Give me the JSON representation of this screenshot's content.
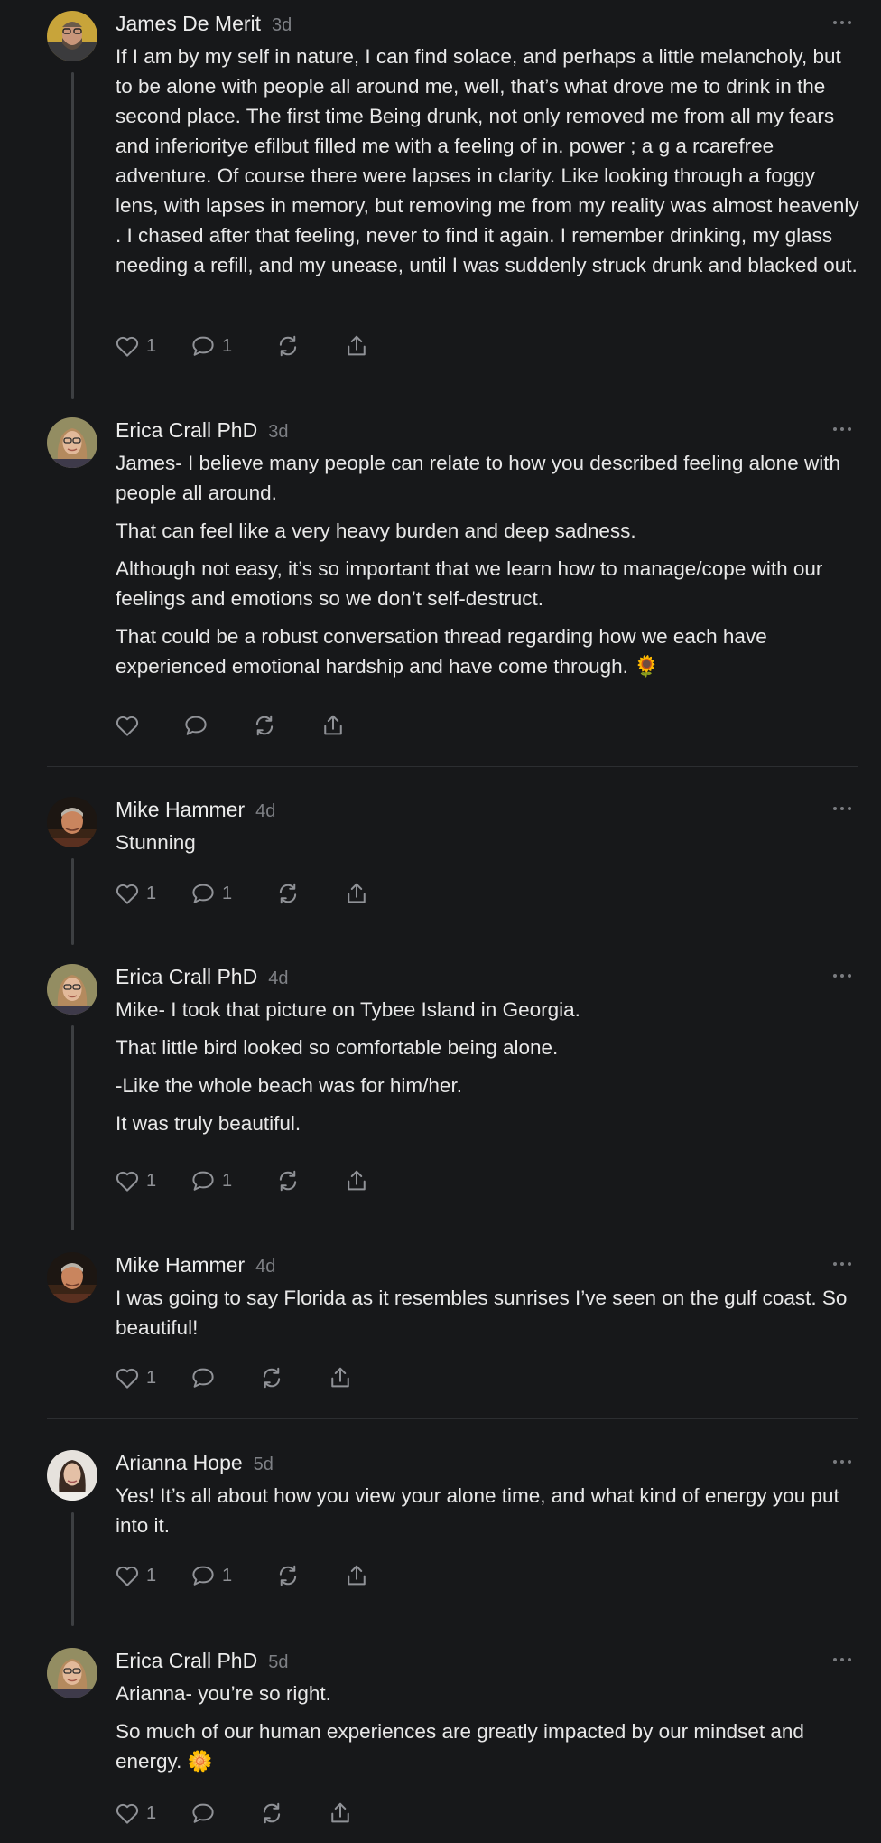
{
  "colors": {
    "background": "#17181a",
    "text": "#e8e8e8",
    "muted": "#7e8085",
    "thread_line": "#3d3f42"
  },
  "comments": [
    {
      "author": "James De Merit",
      "time": "3d",
      "avatar": "man-glasses-beard-avatar",
      "paragraphs": [
        "If I am by my self in nature, I can find solace, and perhaps a little melancholy, but to be alone with people all around me, well, that’s what drove me to drink in the second place. The first time Being drunk, not only removed me from all my fears and inferioritye efilbut filled me with a feeling of in. power ; a g a rcarefree adventure. Of course there were lapses in clarity. Like looking through a foggy lens, with lapses in memory, but removing me from my reality was almost heavenly . I chased after that feeling, never to find it again. I remember drinking, my glass needing a refill, and my unease, until I was suddenly struck drunk and blacked out."
      ],
      "likes": "1",
      "replies": "1"
    },
    {
      "author": "Erica Crall PhD",
      "time": "3d",
      "avatar": "woman-glasses-avatar",
      "paragraphs": [
        "James- I believe many people can relate to how you described feeling alone with people all around.",
        "That can feel like a very heavy burden and deep sadness.",
        "Although not easy, it’s so important that we learn how to manage/cope with our feelings and emotions so we don’t self-destruct.",
        "That could be a robust conversation thread regarding how we each have experienced emotional hardship and have come through. 🌻"
      ],
      "likes": "",
      "replies": ""
    },
    {
      "author": "Mike Hammer",
      "time": "4d",
      "avatar": "man-sunset-avatar",
      "paragraphs": [
        "Stunning"
      ],
      "likes": "1",
      "replies": "1"
    },
    {
      "author": "Erica Crall PhD",
      "time": "4d",
      "avatar": "woman-glasses-avatar",
      "paragraphs": [
        "Mike- I took that picture on Tybee Island in Georgia.",
        "That little bird looked so comfortable being alone.",
        "-Like the whole beach was for him/her.",
        "It was truly beautiful."
      ],
      "likes": "1",
      "replies": "1"
    },
    {
      "author": "Mike Hammer",
      "time": "4d",
      "avatar": "man-sunset-avatar",
      "paragraphs": [
        "I was going to say Florida as it resembles sunrises I’ve seen on the gulf coast. So beautiful!"
      ],
      "likes": "1",
      "replies": ""
    },
    {
      "author": "Arianna Hope",
      "time": "5d",
      "avatar": "woman-dark-hair-avatar",
      "paragraphs": [
        "Yes! It’s all about how you view your alone time, and what kind of energy you put into it."
      ],
      "likes": "1",
      "replies": "1"
    },
    {
      "author": "Erica Crall PhD",
      "time": "5d",
      "avatar": "woman-glasses-avatar",
      "paragraphs": [
        "Arianna- you’re so right.",
        "So much of our human experiences are greatly impacted by our mindset and energy. 🌼"
      ],
      "likes": "1",
      "replies": ""
    }
  ]
}
